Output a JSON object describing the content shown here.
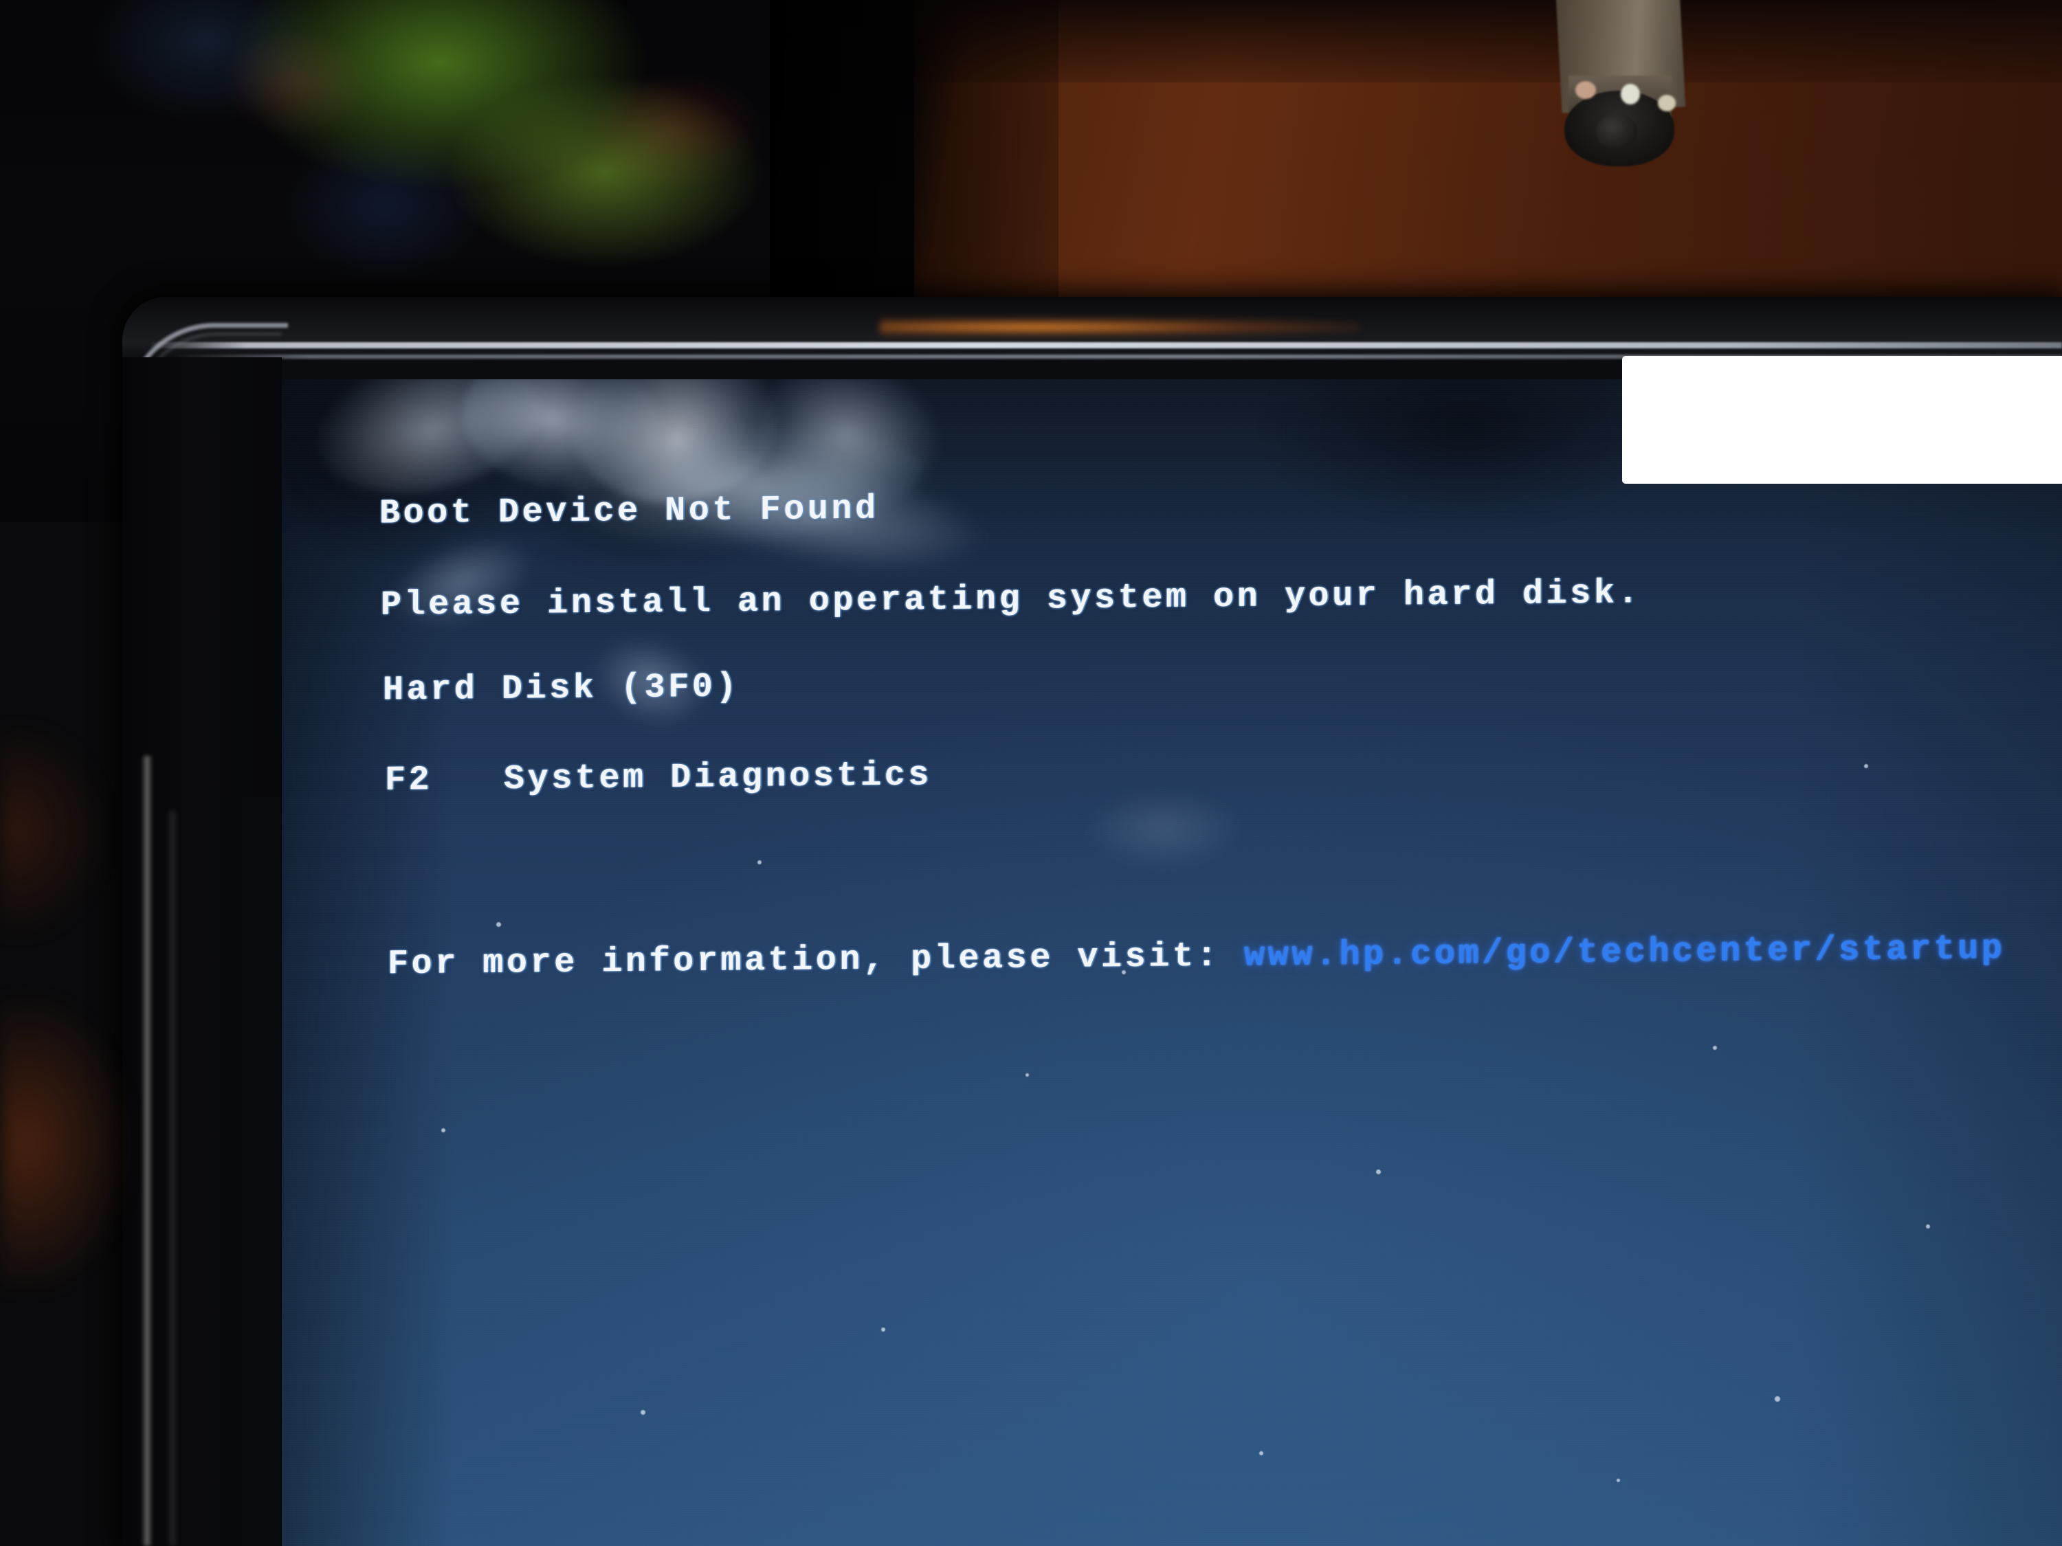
{
  "scene": {
    "description": "photograph-of-laptop-bios-error-screen",
    "device": "laptop",
    "screen_background_color": "#1d3250",
    "bezel_color": "#0a0b0e"
  },
  "bios_screen": {
    "title": "Boot Device Not Found",
    "instruction": "Please install an operating system on your hard disk.",
    "error_code_line": "Hard Disk (3F0)",
    "options": [
      {
        "key": "F2",
        "label": "System Diagnostics",
        "spacing": "   "
      }
    ],
    "footer": {
      "prefix": "For more information, please visit: ",
      "url": "www.hp.com/go/techcenter/startup",
      "url_color": "#2f7df0"
    },
    "text_color": "#f2f6fb"
  },
  "overlay": {
    "redaction_block": {
      "label": "white-redaction-rectangle",
      "color": "#ffffff"
    }
  },
  "environment": {
    "objects": [
      "dark-room-background",
      "green-boxes",
      "wooden-floor",
      "office-chair-leg",
      "caster-wheel"
    ]
  }
}
